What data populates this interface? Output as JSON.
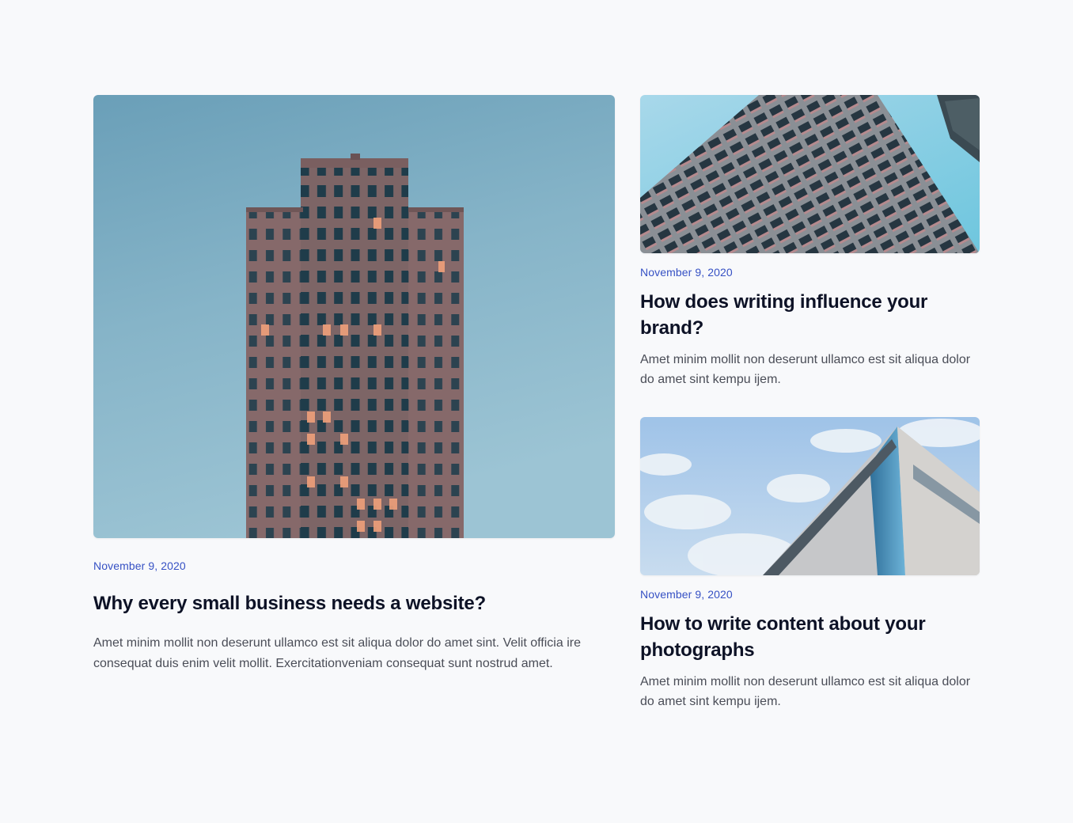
{
  "featured": {
    "image_icon": "tower-building-photo",
    "date": "November 9, 2020",
    "title": "Why every small business needs a website?",
    "excerpt": "Amet minim mollit non deserunt ullamco est sit aliqua dolor do amet sint. Velit officia ire consequat duis enim velit mollit. Exercitationveniam consequat sunt nostrud amet."
  },
  "posts": [
    {
      "image_icon": "skyscraper-facade-photo",
      "date": "November 9, 2020",
      "title": "How does writing influence your brand?",
      "excerpt": "Amet minim mollit non deserunt ullamco est sit aliqua dolor do amet sint kempu ijem."
    },
    {
      "image_icon": "glass-building-corner-photo",
      "date": "November 9, 2020",
      "title": "How to write content about your photographs",
      "excerpt": "Amet minim mollit non deserunt ullamco est sit aliqua dolor do amet sint kempu ijem."
    }
  ],
  "colors": {
    "background": "#f8f9fb",
    "date": "#3651c4",
    "title": "#0d1226",
    "excerpt": "#4a4d57"
  }
}
